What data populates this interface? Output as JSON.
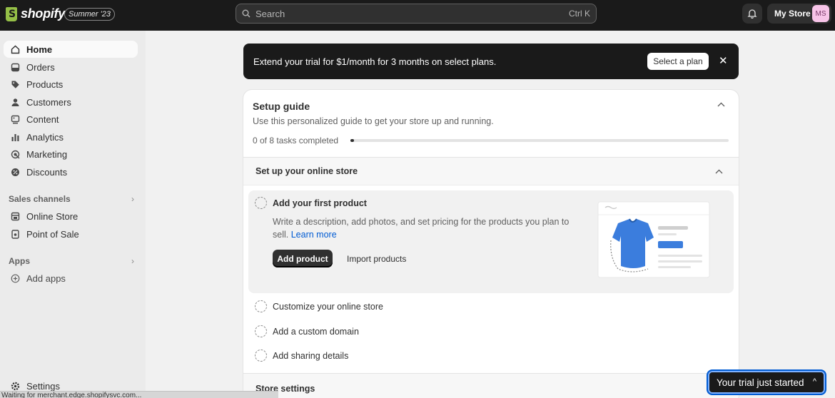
{
  "header": {
    "logo_text": "shopify",
    "edition_badge": "Summer '23",
    "search_placeholder": "Search",
    "search_shortcut": "Ctrl K",
    "store_name": "My Store",
    "avatar_initials": "MS"
  },
  "sidebar": {
    "items": [
      {
        "label": "Home",
        "icon": "home-icon",
        "active": true
      },
      {
        "label": "Orders",
        "icon": "orders-icon"
      },
      {
        "label": "Products",
        "icon": "tag-icon"
      },
      {
        "label": "Customers",
        "icon": "person-icon"
      },
      {
        "label": "Content",
        "icon": "content-icon"
      },
      {
        "label": "Analytics",
        "icon": "bar-chart-icon"
      },
      {
        "label": "Marketing",
        "icon": "target-icon"
      },
      {
        "label": "Discounts",
        "icon": "discount-icon"
      }
    ],
    "sales_channels_label": "Sales channels",
    "channels": [
      {
        "label": "Online Store",
        "icon": "store-icon"
      },
      {
        "label": "Point of Sale",
        "icon": "pos-icon"
      }
    ],
    "apps_label": "Apps",
    "add_apps_label": "Add apps",
    "settings_label": "Settings"
  },
  "banner": {
    "text": "Extend your trial for $1/month for 3 months on select plans.",
    "button_label": "Select a plan",
    "close_glyph": "✕"
  },
  "setup_guide": {
    "title": "Setup guide",
    "subtitle": "Use this personalized guide to get your store up and running.",
    "progress_text": "0 of 8 tasks completed",
    "progress_fraction": 0.01,
    "section_title": "Set up your online store",
    "active_task": {
      "title": "Add your first product",
      "description": "Write a description, add photos, and set pricing for the products you plan to sell.",
      "learn_more": "Learn more",
      "primary_button": "Add product",
      "secondary_button": "Import products"
    },
    "tasks": [
      "Customize your online store",
      "Add a custom domain",
      "Add sharing details"
    ],
    "next_section": "Store settings"
  },
  "trial_button": {
    "label": "Your trial just started",
    "caret": "^"
  },
  "status_bar": {
    "text": "Waiting for merchant.edge.shopifysvc.com..."
  },
  "colors": {
    "topbar": "#1a1a1a",
    "sidebar": "#ebebeb",
    "link": "#005bd3",
    "logo_green": "#95bf47",
    "avatar_bg": "#f7c4e8"
  }
}
